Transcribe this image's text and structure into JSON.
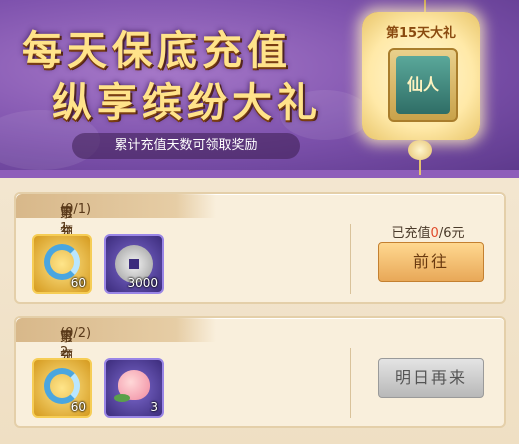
{
  "banner": {
    "title_line1": "每天保底充值",
    "title_line2": "纵享缤纷大礼",
    "subtitle": "累计充值天数可领取奖励"
  },
  "lantern": {
    "label": "第15天大礼",
    "reward_name": "仙人"
  },
  "rewards": [
    {
      "prefix": "累充",
      "day": "第1天",
      "suffix": "可领",
      "progress": "(0/1)",
      "items": [
        {
          "icon": "ring-icon",
          "qty": "60"
        },
        {
          "icon": "coin-icon",
          "qty": "3000"
        }
      ],
      "status_prefix": "已充值",
      "status_value": "0",
      "status_suffix": "/6元",
      "button": "前往"
    },
    {
      "prefix": "累充",
      "day": "第2天",
      "suffix": "可领",
      "progress": "(0/2)",
      "items": [
        {
          "icon": "ring-icon",
          "qty": "60"
        },
        {
          "icon": "peach-icon",
          "qty": "3"
        }
      ],
      "button": "明日再来"
    }
  ],
  "colors": {
    "highlight_green": "#3aa64a",
    "banner_purple": "#7e52ad",
    "title_gold": "#ffe38a"
  }
}
